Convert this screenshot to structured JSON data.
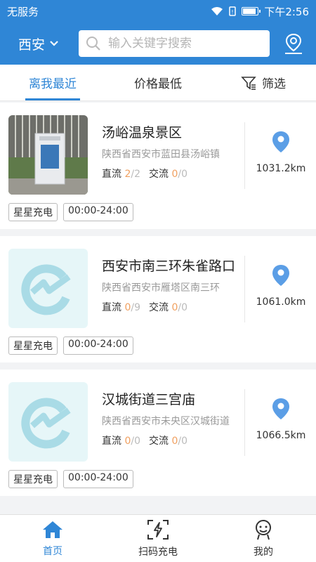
{
  "status": {
    "carrier": "无服务",
    "time": "下午2:56"
  },
  "header": {
    "city": "西安",
    "search_placeholder": "输入关键字搜索"
  },
  "tabs": [
    {
      "label": "离我最近",
      "active": true
    },
    {
      "label": "价格最低",
      "active": false
    },
    {
      "label": "筛选",
      "active": false
    }
  ],
  "stations": [
    {
      "title": "汤峪温泉景区",
      "address": "陕西省西安市蓝田县汤峪镇",
      "dc_label": "直流",
      "dc_avail": "2",
      "dc_total": "/2",
      "ac_label": "交流",
      "ac_avail": "0",
      "ac_total": "/0",
      "distance": "1031.2km",
      "operator": "星星充电",
      "hours": "00:00-24:00"
    },
    {
      "title": "西安市南三环朱雀路口",
      "address": "陕西省西安市雁塔区南三环",
      "dc_label": "直流",
      "dc_avail": "0",
      "dc_total": "/9",
      "ac_label": "交流",
      "ac_avail": "0",
      "ac_total": "/0",
      "distance": "1061.0km",
      "operator": "星星充电",
      "hours": "00:00-24:00"
    },
    {
      "title": "汉城街道三宫庙",
      "address": "陕西省西安市未央区汉城街道",
      "dc_label": "直流",
      "dc_avail": "0",
      "dc_total": "/0",
      "ac_label": "交流",
      "ac_avail": "0",
      "ac_total": "/0",
      "distance": "1066.5km",
      "operator": "星星充电",
      "hours": "00:00-24:00"
    }
  ],
  "nav": [
    {
      "label": "首页",
      "icon": "home-icon",
      "active": true
    },
    {
      "label": "扫码充电",
      "icon": "scan-charge-icon",
      "active": false
    },
    {
      "label": "我的",
      "icon": "profile-icon",
      "active": false
    }
  ],
  "colors": {
    "primary": "#2f86d6",
    "available": "#f0a060",
    "pin": "#5b9ee6"
  }
}
